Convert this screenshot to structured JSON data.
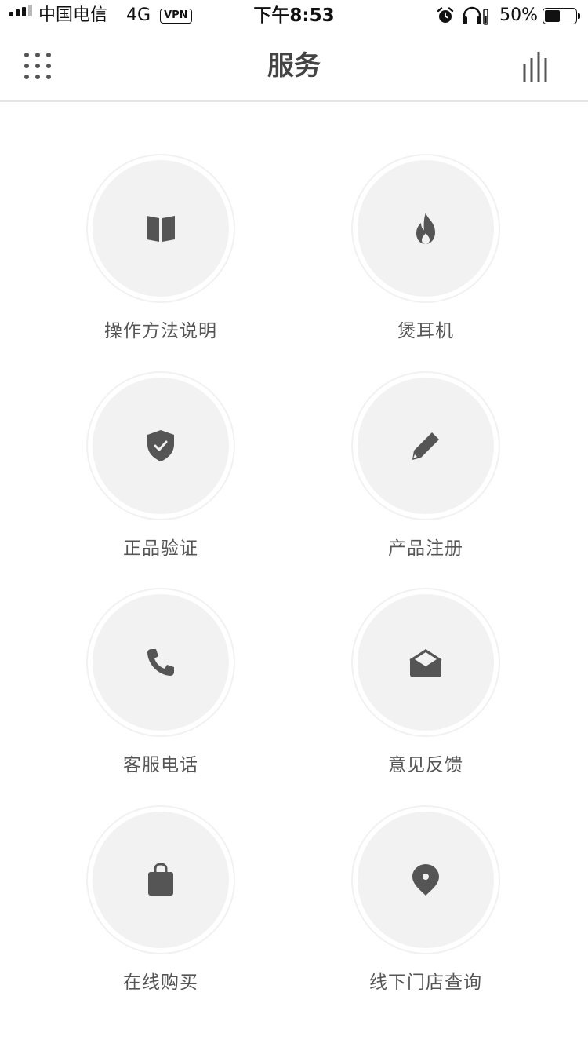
{
  "status_bar": {
    "carrier": "中国电信",
    "network": "4G",
    "vpn": "VPN",
    "time": "下午8:53",
    "battery_text": "50%",
    "battery_level": 0.5
  },
  "nav": {
    "title": "服务",
    "menu_icon": "grid-dots-icon",
    "right_icon": "bar-chart-icon"
  },
  "services": [
    {
      "label": "操作方法说明",
      "icon": "book-icon"
    },
    {
      "label": "煲耳机",
      "icon": "flame-icon"
    },
    {
      "label": "正品验证",
      "icon": "shield-check-icon"
    },
    {
      "label": "产品注册",
      "icon": "pencil-icon"
    },
    {
      "label": "客服电话",
      "icon": "phone-icon"
    },
    {
      "label": "意见反馈",
      "icon": "envelope-open-icon"
    },
    {
      "label": "在线购买",
      "icon": "shopping-bag-icon"
    },
    {
      "label": "线下门店查询",
      "icon": "map-pin-icon"
    }
  ],
  "colors": {
    "icon": "#555555",
    "circle": "#f2f2f2",
    "label": "#555555"
  }
}
